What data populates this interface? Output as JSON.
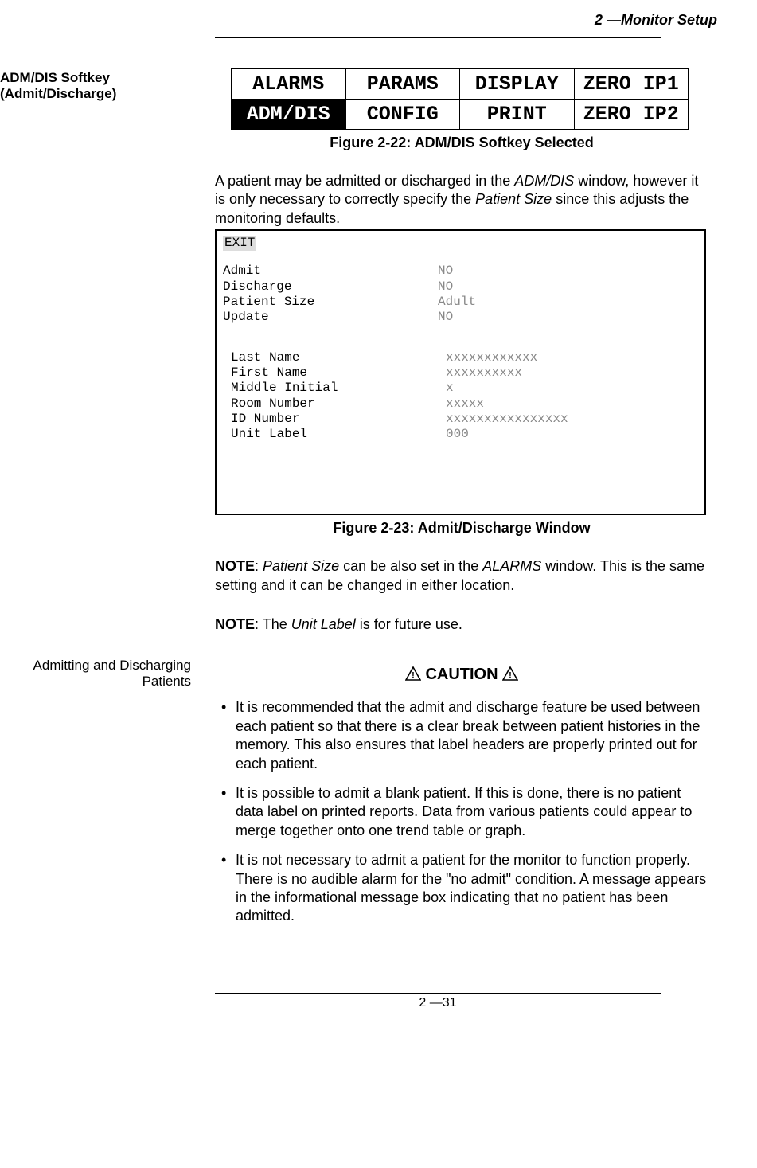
{
  "header": {
    "running": "2 —Monitor Setup"
  },
  "section1": {
    "side_label": "ADM/DIS Softkey (Admit/Discharge)",
    "softkeys": {
      "row1": [
        "ALARMS",
        "PARAMS",
        "DISPLAY",
        "ZERO IP1"
      ],
      "row2": [
        "ADM/DIS",
        "CONFIG",
        "PRINT",
        "ZERO IP2"
      ]
    },
    "fig1_caption": "Figure 2-22: ADM/DIS Softkey Selected",
    "para1_a": "A patient may be admitted or discharged in the ",
    "para1_i1": "ADM/DIS",
    "para1_b": " window, however it is only necessary to correctly specify the ",
    "para1_i2": "Patient Size",
    "para1_c": " since this adjusts the monitoring defaults.",
    "adm_window": {
      "exit": "EXIT",
      "group1": [
        {
          "label": "Admit",
          "value": "NO"
        },
        {
          "label": "Discharge",
          "value": "NO"
        },
        {
          "label": "Patient Size",
          "value": "Adult"
        },
        {
          "label": "Update",
          "value": "NO"
        }
      ],
      "group2": [
        {
          "label": "Last Name",
          "value": "xxxxxxxxxxxx"
        },
        {
          "label": "First Name",
          "value": "xxxxxxxxxx"
        },
        {
          "label": "Middle Initial",
          "value": "x"
        },
        {
          "label": "Room Number",
          "value": "xxxxx"
        },
        {
          "label": "ID Number",
          "value": "xxxxxxxxxxxxxxxx"
        },
        {
          "label": "Unit Label",
          "value": "000"
        }
      ]
    },
    "fig2_caption": "Figure 2-23: Admit/Discharge Window",
    "note1_prefix": "NOTE",
    "note1_a": ": ",
    "note1_i1": "Patient Size",
    "note1_b": " can be also set in the ",
    "note1_i2": "ALARMS",
    "note1_c": " window. This is the same setting and it can be changed in either location.",
    "note2_prefix": "NOTE",
    "note2_a": ": The ",
    "note2_i1": "Unit Label",
    "note2_b": " is for future use."
  },
  "section2": {
    "side_label": "Admitting and Discharging Patients",
    "caution_label": "CAUTION",
    "bullets": [
      "It is recommended that the admit and discharge feature be used between each patient so that there is a clear break between patient histories in the memory. This also ensures that label headers are properly printed out for each patient.",
      "It is possible to admit a blank patient. If this is done, there is no patient data label on printed reports. Data from various patients could appear to merge together onto one trend table or graph.",
      "It is not necessary to admit a patient for the monitor to function properly. There is no audible alarm for the \"no admit\" condition. A message appears in the informational message box indicating that no patient has been admitted."
    ]
  },
  "footer": {
    "page_number": "2 —31"
  }
}
